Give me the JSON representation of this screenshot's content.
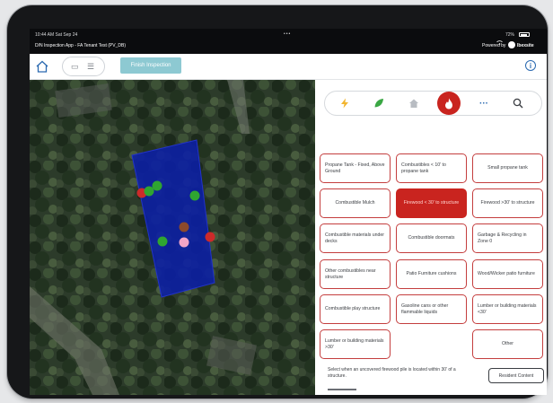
{
  "status_bar": {
    "time_date": "10:44 AM  Sat Sep 24",
    "multitask_dots": "•••",
    "battery": "72%"
  },
  "app_header": {
    "title": "D/N Inspection App - FA Tenant Test (PV_DB)",
    "powered_by": "Powered by",
    "brand": "Ibexsite"
  },
  "toolbar": {
    "finish_label": "Finish Inspection",
    "info_glyph": "i"
  },
  "map": {
    "zone_color": "#0b1fa6",
    "markers": [
      {
        "color": "#cc2a2a"
      },
      {
        "color": "#2fa531"
      },
      {
        "color": "#2fa531"
      },
      {
        "color": "#2fa531"
      },
      {
        "color": "#8c4a2c"
      },
      {
        "color": "#2fa531"
      },
      {
        "color": "#f4a6c7"
      },
      {
        "color": "#cc2a2a"
      }
    ]
  },
  "categories": [
    {
      "icon": "lightning-icon",
      "color": "#f2b52f"
    },
    {
      "icon": "leaf-icon",
      "color": "#3aa744"
    },
    {
      "icon": "house-icon",
      "color": "#b8bcc2"
    },
    {
      "icon": "flame-icon",
      "color": "#c9241f",
      "selected": true
    },
    {
      "icon": "more-icon",
      "color": "#2a69b0"
    },
    {
      "icon": "search-icon",
      "color": "#3a3d42"
    }
  ],
  "tiles": [
    {
      "label": "Propane Tank - Fixed, Above Ground"
    },
    {
      "label": "Combustibles < 10' to propane tank"
    },
    {
      "label": "Small propane tank"
    },
    {
      "label": "Combustible Mulch"
    },
    {
      "label": "Firewood < 30' to structure",
      "active": true
    },
    {
      "label": "Firewood >30' to structure"
    },
    {
      "label": "Combustible materials under decks"
    },
    {
      "label": "Combustible doormats"
    },
    {
      "label": "Garbage & Recycling in Zone 0"
    },
    {
      "label": "Other combustibles near structure"
    },
    {
      "label": "Patio Furniture cushions"
    },
    {
      "label": "Wood/Wicker patio furniture"
    },
    {
      "label": "Combustible play structure"
    },
    {
      "label": "Gasoline cans or other flammable liquids"
    },
    {
      "label": "Lumber or building materials <30'"
    },
    {
      "label": "Lumber or building materials >30'"
    },
    {
      "label": "Other"
    }
  ],
  "footer": {
    "note": "Select when an uncovered firewood pile is located within 30' of a structure.",
    "resident_button": "Resident Content"
  }
}
